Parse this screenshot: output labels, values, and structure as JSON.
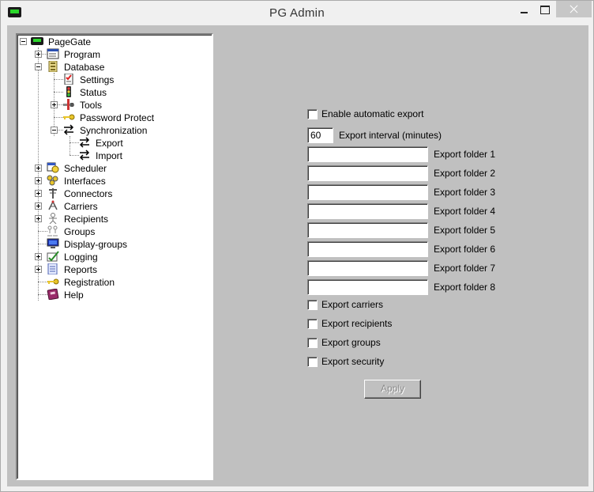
{
  "window": {
    "title": "PG Admin"
  },
  "tree": {
    "root": "PageGate",
    "items": [
      {
        "label": "Program",
        "icon": "program-icon"
      },
      {
        "label": "Database",
        "icon": "database-icon"
      },
      {
        "label": "Settings",
        "icon": "settings-icon"
      },
      {
        "label": "Status",
        "icon": "status-icon"
      },
      {
        "label": "Tools",
        "icon": "tools-icon"
      },
      {
        "label": "Password Protect",
        "icon": "key-icon"
      },
      {
        "label": "Synchronization",
        "icon": "sync-icon"
      },
      {
        "label": "Export",
        "icon": "sync-icon"
      },
      {
        "label": "Import",
        "icon": "sync-icon"
      },
      {
        "label": "Scheduler",
        "icon": "scheduler-icon"
      },
      {
        "label": "Interfaces",
        "icon": "interfaces-icon"
      },
      {
        "label": "Connectors",
        "icon": "connectors-icon"
      },
      {
        "label": "Carriers",
        "icon": "carriers-icon"
      },
      {
        "label": "Recipients",
        "icon": "recipients-icon"
      },
      {
        "label": "Groups",
        "icon": "groups-icon"
      },
      {
        "label": "Display-groups",
        "icon": "display-groups-icon"
      },
      {
        "label": "Logging",
        "icon": "logging-icon"
      },
      {
        "label": "Reports",
        "icon": "reports-icon"
      },
      {
        "label": "Registration",
        "icon": "key-icon"
      },
      {
        "label": "Help",
        "icon": "help-icon"
      }
    ]
  },
  "export": {
    "enable_label": "Enable automatic export",
    "interval_value": "60",
    "interval_label": "Export interval (minutes)",
    "folders": [
      {
        "label": "Export folder 1",
        "value": ""
      },
      {
        "label": "Export folder 2",
        "value": ""
      },
      {
        "label": "Export folder 3",
        "value": ""
      },
      {
        "label": "Export folder 4",
        "value": ""
      },
      {
        "label": "Export folder 5",
        "value": ""
      },
      {
        "label": "Export folder 6",
        "value": ""
      },
      {
        "label": "Export folder 7",
        "value": ""
      },
      {
        "label": "Export folder 8",
        "value": ""
      }
    ],
    "options": [
      {
        "label": "Export carriers"
      },
      {
        "label": "Export recipients"
      },
      {
        "label": "Export groups"
      },
      {
        "label": "Export security"
      }
    ],
    "apply_label": "Apply"
  }
}
